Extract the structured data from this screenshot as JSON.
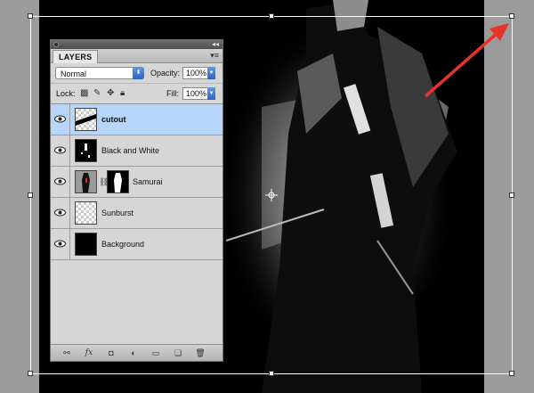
{
  "panel": {
    "tab_label": "LAYERS",
    "blend_mode": "Normal",
    "opacity_label": "Opacity:",
    "opacity_value": "100%",
    "lock_label": "Lock:",
    "fill_label": "Fill:",
    "fill_value": "100%"
  },
  "layers": [
    {
      "name": "cutout",
      "selected": true
    },
    {
      "name": "Black and White",
      "selected": false
    },
    {
      "name": "Samurai",
      "selected": false
    },
    {
      "name": "Sunburst",
      "selected": false
    },
    {
      "name": "Background",
      "selected": false
    }
  ],
  "colors": {
    "arrow": "#e8322a",
    "selection": "#b6d5fb"
  },
  "icons": [
    "eye-icon",
    "link-icon",
    "fx-icon",
    "mask-icon",
    "adjustment-icon",
    "folder-icon",
    "new-layer-icon",
    "trash-icon"
  ]
}
